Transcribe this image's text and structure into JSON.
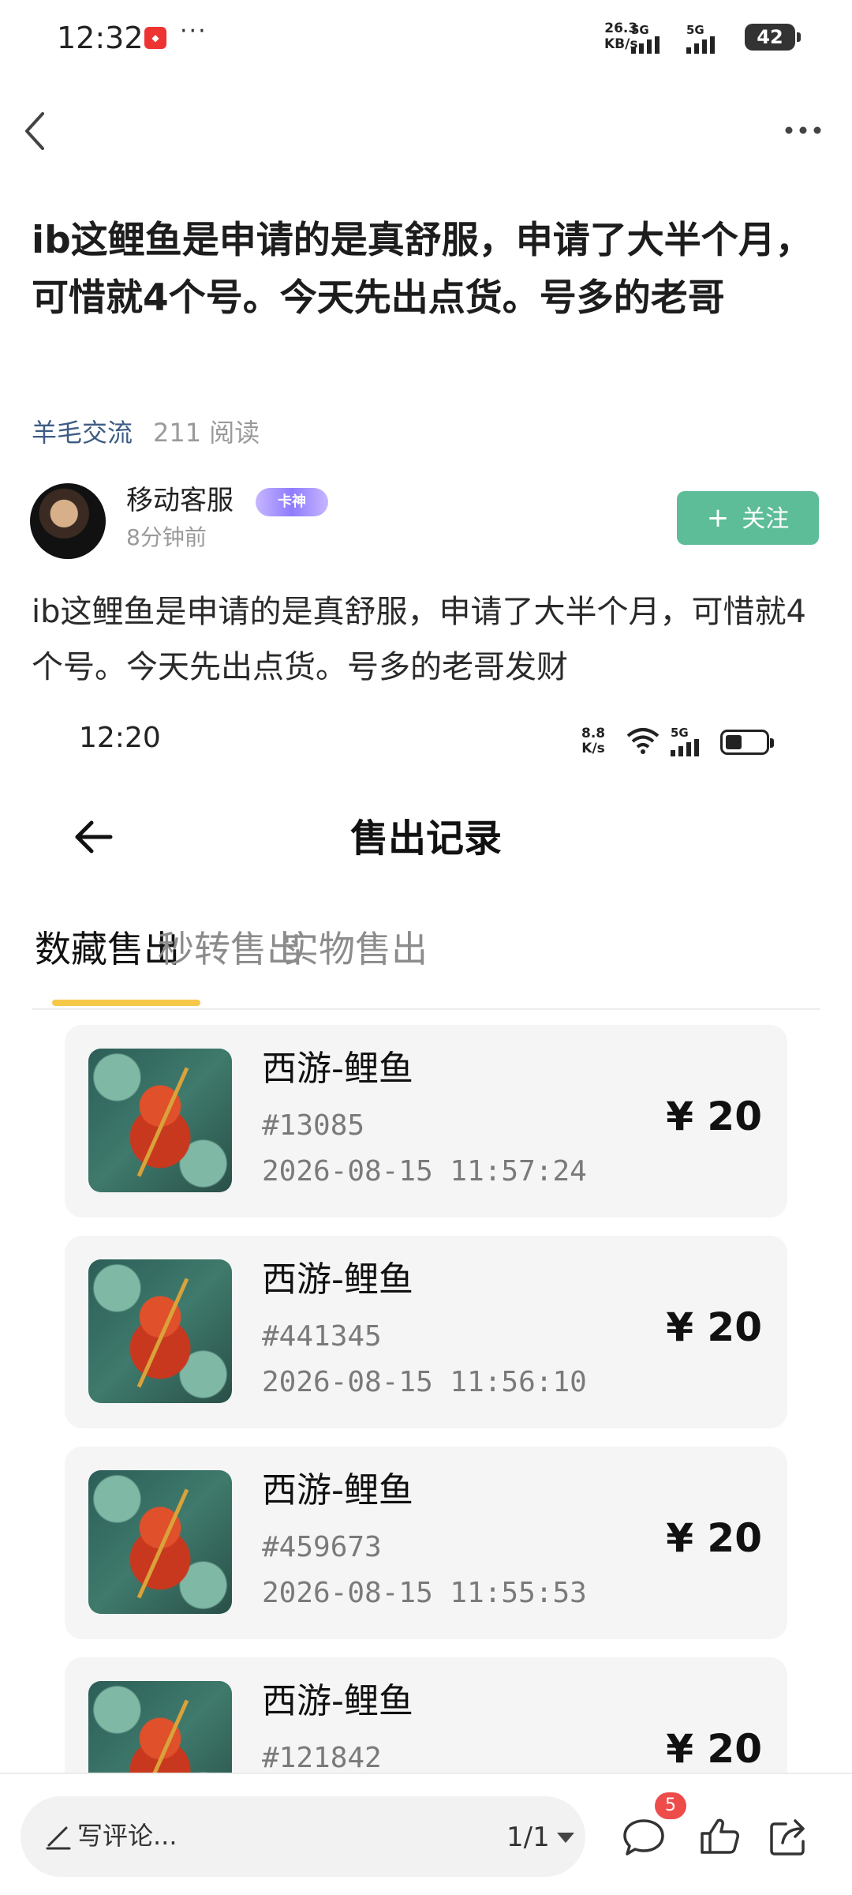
{
  "status_bar": {
    "time": "12:32",
    "more": "···",
    "net_speed": "26.3",
    "net_unit": "KB/s",
    "net1": "5G",
    "net2": "5G",
    "battery": "42"
  },
  "post": {
    "title": "ib这鲤鱼是申请的是真舒服，申请了大半个月，可惜就4个号。今天先出点货。号多的老哥",
    "category": "羊毛交流",
    "reads": "211 阅读",
    "author": {
      "name": "移动客服",
      "badge": "卡神",
      "time": "8分钟前"
    },
    "follow_label": "关注",
    "body": "ib这鲤鱼是申请的是真舒服，申请了大半个月，可惜就4个号。今天先出点货。号多的老哥发财"
  },
  "screenshot": {
    "time": "12:20",
    "net_speed": "8.8",
    "net_unit": "K/s",
    "net": "5G",
    "page_title": "售出记录",
    "tabs": [
      {
        "label": "数藏售出",
        "active": true
      },
      {
        "label": "秒转售出",
        "active": false
      },
      {
        "label": "实物售出",
        "active": false
      }
    ],
    "records": [
      {
        "name": "西游-鲤鱼",
        "id": "#13085",
        "date": "2026-08-15 11:57:24",
        "price": "¥ 20"
      },
      {
        "name": "西游-鲤鱼",
        "id": "#441345",
        "date": "2026-08-15 11:56:10",
        "price": "¥ 20"
      },
      {
        "name": "西游-鲤鱼",
        "id": "#459673",
        "date": "2026-08-15 11:55:53",
        "price": "¥ 20"
      },
      {
        "name": "西游-鲤鱼",
        "id": "#121842",
        "date": "",
        "price": "¥ 20"
      }
    ]
  },
  "bottom_bar": {
    "comment_placeholder": "写评论...",
    "page_indicator": "1/1",
    "comment_count": "5"
  },
  "colors": {
    "follow_button": "#5dbd98",
    "category_link": "#3d5c84",
    "tab_indicator": "#f5c84a",
    "badge": "#ee4b4b"
  }
}
